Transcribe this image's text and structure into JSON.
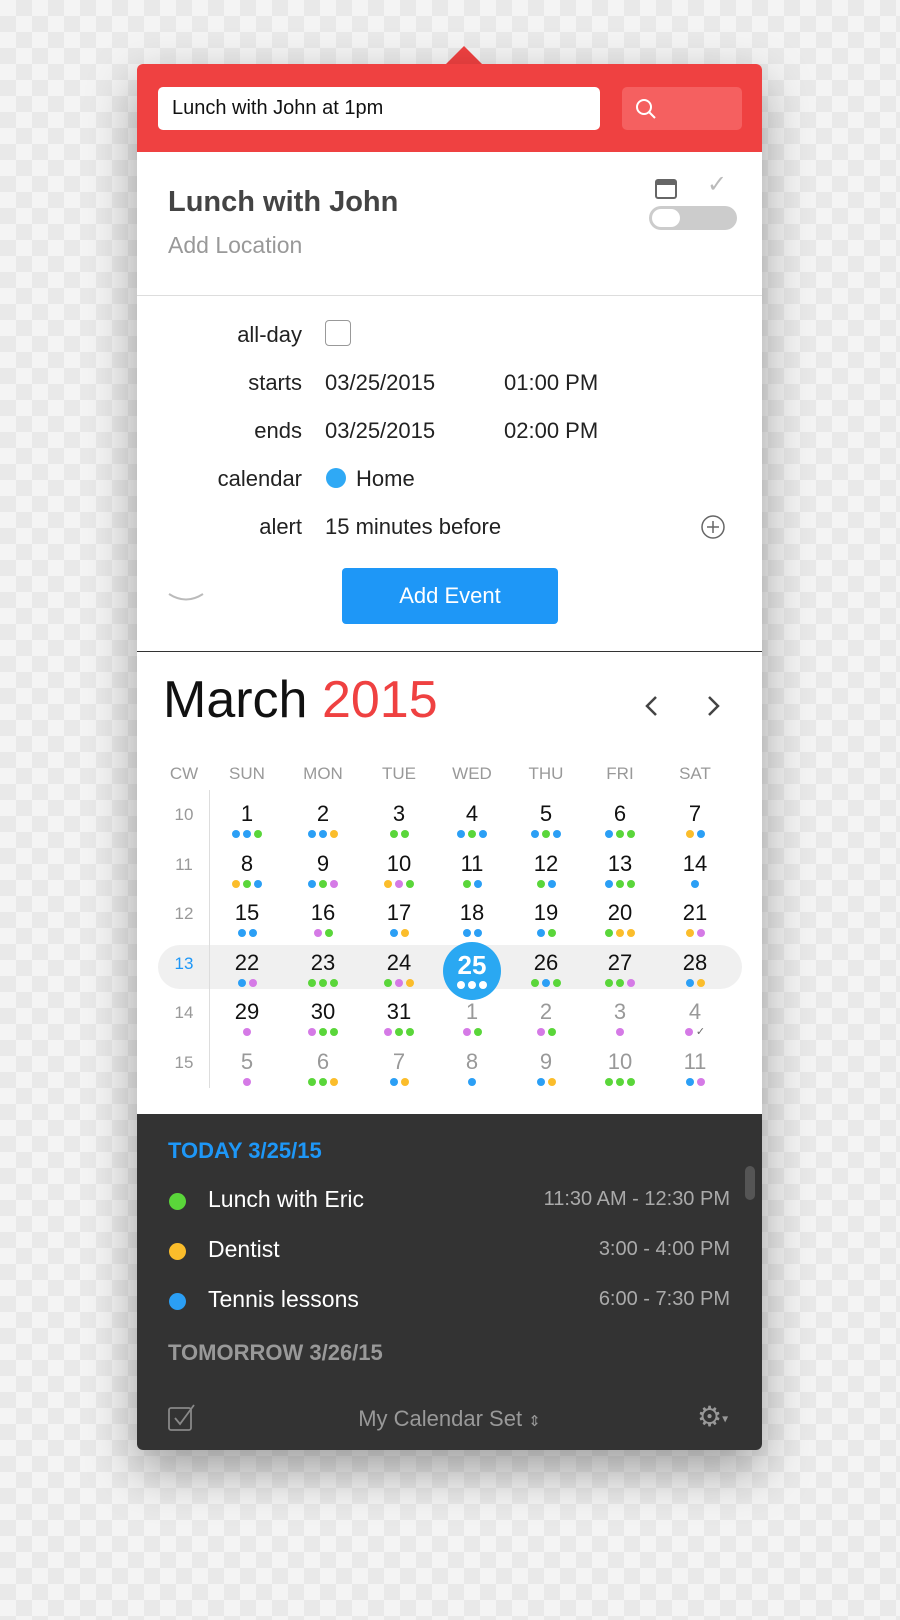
{
  "search": {
    "value": "Lunch with John at 1pm",
    "icon": "search-icon"
  },
  "event": {
    "title": "Lunch with John",
    "location_placeholder": "Add Location"
  },
  "form": {
    "allday_label": "all-day",
    "allday_checked": false,
    "starts_label": "starts",
    "starts_date": "03/25/2015",
    "starts_time": "01:00 PM",
    "ends_label": "ends",
    "ends_date": "03/25/2015",
    "ends_time": "02:00 PM",
    "calendar_label": "calendar",
    "calendar_value": "Home",
    "calendar_color": "#2fa9f5",
    "alert_label": "alert",
    "alert_value": "15 minutes before",
    "add_button": "Add Event"
  },
  "calendar": {
    "month": "March",
    "year": "2015",
    "cw_header": "CW",
    "weekdays": [
      "SUN",
      "MON",
      "TUE",
      "WED",
      "THU",
      "FRI",
      "SAT"
    ],
    "colors": {
      "b": "#2b9ff5",
      "g": "#5ad63a",
      "y": "#fbbd2b",
      "p": "#d57ae6"
    },
    "today": "25",
    "weeks": [
      {
        "cw": "10",
        "days": [
          {
            "n": "1",
            "d": "bbg"
          },
          {
            "n": "2",
            "d": "bby"
          },
          {
            "n": "3",
            "d": "gg"
          },
          {
            "n": "4",
            "d": "bgb"
          },
          {
            "n": "5",
            "d": "bgb"
          },
          {
            "n": "6",
            "d": "bgg"
          },
          {
            "n": "7",
            "d": "yb"
          }
        ]
      },
      {
        "cw": "11",
        "days": [
          {
            "n": "8",
            "d": "ygb"
          },
          {
            "n": "9",
            "d": "bgp"
          },
          {
            "n": "10",
            "d": "ypg"
          },
          {
            "n": "11",
            "d": "gb"
          },
          {
            "n": "12",
            "d": "gb"
          },
          {
            "n": "13",
            "d": "bgg"
          },
          {
            "n": "14",
            "d": "b"
          }
        ]
      },
      {
        "cw": "12",
        "days": [
          {
            "n": "15",
            "d": "bb"
          },
          {
            "n": "16",
            "d": "pg"
          },
          {
            "n": "17",
            "d": "by"
          },
          {
            "n": "18",
            "d": "bb"
          },
          {
            "n": "19",
            "d": "bg"
          },
          {
            "n": "20",
            "d": "gyy"
          },
          {
            "n": "21",
            "d": "yp"
          }
        ]
      },
      {
        "cw": "13",
        "current": true,
        "days": [
          {
            "n": "22",
            "d": "bp"
          },
          {
            "n": "23",
            "d": "ggg"
          },
          {
            "n": "24",
            "d": "gpy"
          },
          {
            "n": "25",
            "d": "www"
          },
          {
            "n": "26",
            "d": "gbg"
          },
          {
            "n": "27",
            "d": "ggp"
          },
          {
            "n": "28",
            "d": "by"
          }
        ]
      },
      {
        "cw": "14",
        "days": [
          {
            "n": "29",
            "d": "p"
          },
          {
            "n": "30",
            "d": "pgg"
          },
          {
            "n": "31",
            "d": "pgg"
          },
          {
            "n": "1",
            "d": "pg",
            "other": true
          },
          {
            "n": "2",
            "d": "pg",
            "other": true
          },
          {
            "n": "3",
            "d": "p",
            "other": true
          },
          {
            "n": "4",
            "d": "p",
            "check": "✓",
            "other": true
          }
        ]
      },
      {
        "cw": "15",
        "days": [
          {
            "n": "5",
            "d": "p",
            "other": true
          },
          {
            "n": "6",
            "d": "ggy",
            "other": true
          },
          {
            "n": "7",
            "d": "by",
            "other": true
          },
          {
            "n": "8",
            "d": "b",
            "other": true
          },
          {
            "n": "9",
            "d": "by",
            "other": true
          },
          {
            "n": "10",
            "d": "ggg",
            "other": true
          },
          {
            "n": "11",
            "d": "bp",
            "other": true
          }
        ]
      }
    ]
  },
  "agenda": {
    "today_header": "TODAY 3/25/15",
    "events": [
      {
        "name": "Lunch with Eric",
        "time": "11:30 AM - 12:30 PM",
        "color": "#5ad63a"
      },
      {
        "name": "Dentist",
        "time": "3:00 - 4:00 PM",
        "color": "#fbbd2b"
      },
      {
        "name": "Tennis lessons",
        "time": "6:00 - 7:30 PM",
        "color": "#2b9ff5"
      }
    ],
    "tomorrow_header": "TOMORROW 3/26/15"
  },
  "footer": {
    "calendar_set": "My Calendar Set",
    "sort_glyph": "⇕"
  }
}
